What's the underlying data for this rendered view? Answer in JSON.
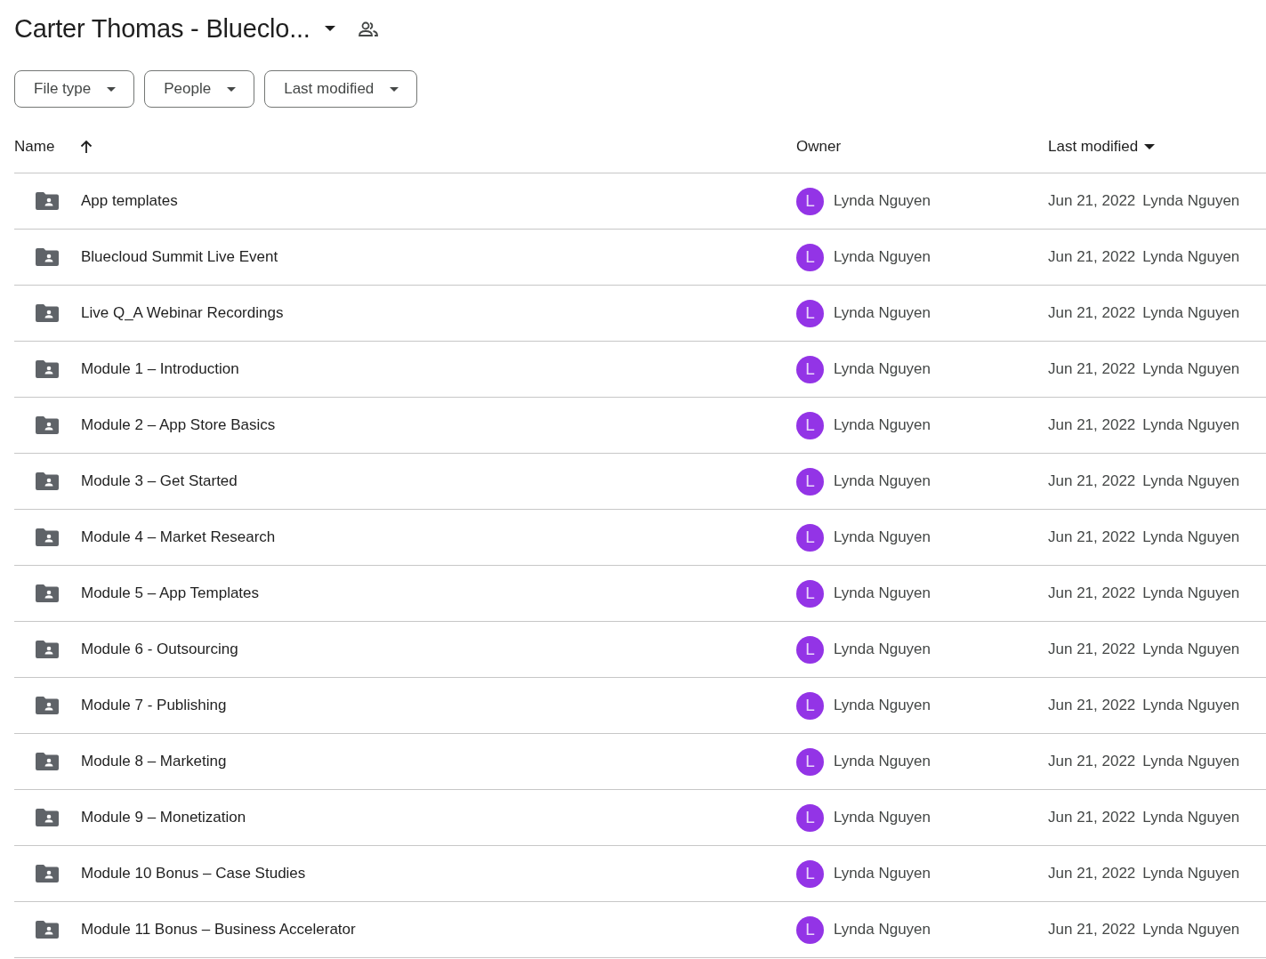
{
  "header": {
    "title": "Carter Thomas - Blueclo..."
  },
  "filters": [
    {
      "label": "File type"
    },
    {
      "label": "People"
    },
    {
      "label": "Last modified"
    }
  ],
  "table": {
    "columns": [
      {
        "label": "Name"
      },
      {
        "label": "Owner"
      },
      {
        "label": "Last modified"
      }
    ],
    "rows": [
      {
        "name": "App templates",
        "owner_initial": "L",
        "owner": "Lynda Nguyen",
        "modified_date": "Jun 21, 2022",
        "modified_by": "Lynda Nguyen"
      },
      {
        "name": "Bluecloud Summit Live Event",
        "owner_initial": "L",
        "owner": "Lynda Nguyen",
        "modified_date": "Jun 21, 2022",
        "modified_by": "Lynda Nguyen"
      },
      {
        "name": "Live Q_A Webinar Recordings",
        "owner_initial": "L",
        "owner": "Lynda Nguyen",
        "modified_date": "Jun 21, 2022",
        "modified_by": "Lynda Nguyen"
      },
      {
        "name": "Module 1 – Introduction",
        "owner_initial": "L",
        "owner": "Lynda Nguyen",
        "modified_date": "Jun 21, 2022",
        "modified_by": "Lynda Nguyen"
      },
      {
        "name": "Module 2 – App Store Basics",
        "owner_initial": "L",
        "owner": "Lynda Nguyen",
        "modified_date": "Jun 21, 2022",
        "modified_by": "Lynda Nguyen"
      },
      {
        "name": "Module 3 – Get Started",
        "owner_initial": "L",
        "owner": "Lynda Nguyen",
        "modified_date": "Jun 21, 2022",
        "modified_by": "Lynda Nguyen"
      },
      {
        "name": "Module 4 – Market Research",
        "owner_initial": "L",
        "owner": "Lynda Nguyen",
        "modified_date": "Jun 21, 2022",
        "modified_by": "Lynda Nguyen"
      },
      {
        "name": "Module 5 – App Templates",
        "owner_initial": "L",
        "owner": "Lynda Nguyen",
        "modified_date": "Jun 21, 2022",
        "modified_by": "Lynda Nguyen"
      },
      {
        "name": "Module 6 - Outsourcing",
        "owner_initial": "L",
        "owner": "Lynda Nguyen",
        "modified_date": "Jun 21, 2022",
        "modified_by": "Lynda Nguyen"
      },
      {
        "name": "Module 7 - Publishing",
        "owner_initial": "L",
        "owner": "Lynda Nguyen",
        "modified_date": "Jun 21, 2022",
        "modified_by": "Lynda Nguyen"
      },
      {
        "name": "Module 8 – Marketing",
        "owner_initial": "L",
        "owner": "Lynda Nguyen",
        "modified_date": "Jun 21, 2022",
        "modified_by": "Lynda Nguyen"
      },
      {
        "name": "Module 9 – Monetization",
        "owner_initial": "L",
        "owner": "Lynda Nguyen",
        "modified_date": "Jun 21, 2022",
        "modified_by": "Lynda Nguyen"
      },
      {
        "name": "Module 10 Bonus – Case Studies",
        "owner_initial": "L",
        "owner": "Lynda Nguyen",
        "modified_date": "Jun 21, 2022",
        "modified_by": "Lynda Nguyen"
      },
      {
        "name": "Module 11 Bonus – Business Accelerator",
        "owner_initial": "L",
        "owner": "Lynda Nguyen",
        "modified_date": "Jun 21, 2022",
        "modified_by": "Lynda Nguyen"
      }
    ]
  }
}
